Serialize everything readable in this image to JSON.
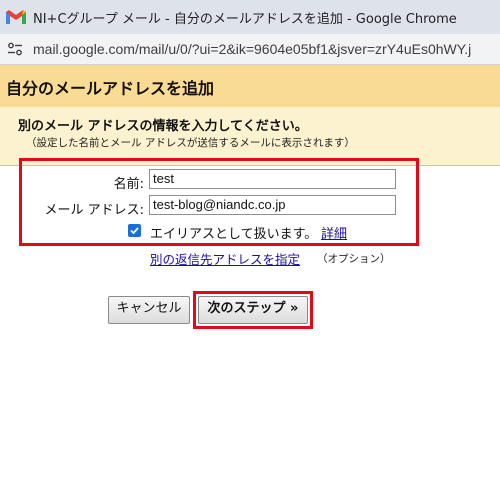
{
  "window": {
    "title": "NI+Cグループ メール - 自分のメールアドレスを追加 - Google Chrome"
  },
  "browser": {
    "url": "mail.google.com/mail/u/0/?ui=2&ik=9604e05bf1&jsver=zrY4uEs0hWY.j"
  },
  "dialog": {
    "title": "自分のメールアドレスを追加",
    "heading": "別のメール アドレスの情報を入力してください。",
    "note": "（設定した名前とメール アドレスが送信するメールに表示されます）",
    "name_label": "名前:",
    "name_value": "test",
    "email_label": "メール アドレス:",
    "email_value": "test-blog@niandc.co.jp",
    "alias_label": "エイリアスとして扱います。",
    "alias_checked": true,
    "detail_link": "詳細",
    "reply_link": "別の返信先アドレスを指定",
    "optional": "（オプション）",
    "cancel_label": "キャンセル",
    "next_label": "次のステップ »"
  },
  "colors": {
    "header": "#fadb93",
    "content": "#fdf2cf",
    "highlight": "#e30a17",
    "link": "#1a0dab",
    "checkbox": "#1a6fd8"
  }
}
